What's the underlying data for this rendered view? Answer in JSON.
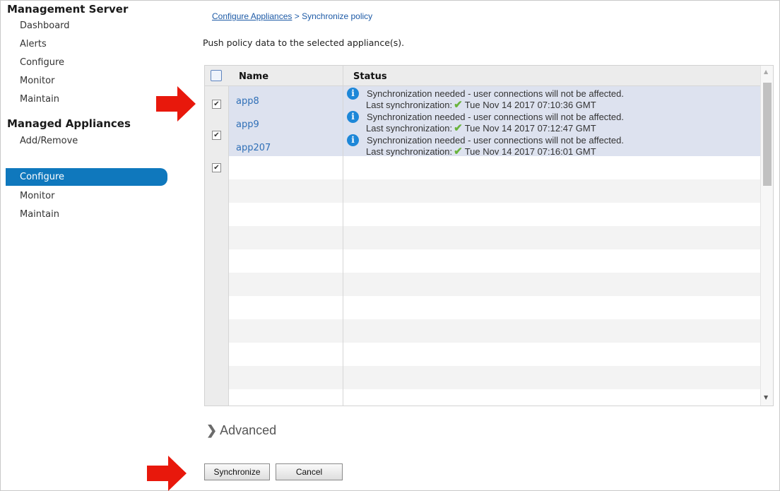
{
  "sidebar": {
    "management_server": {
      "title": "Management Server",
      "items": [
        "Dashboard",
        "Alerts",
        "Configure",
        "Monitor",
        "Maintain"
      ]
    },
    "managed_appliances": {
      "title": "Managed Appliances",
      "items": [
        "Add/Remove",
        "Configure",
        "Monitor",
        "Maintain"
      ],
      "active": "Configure"
    }
  },
  "breadcrumb": {
    "link": "Configure Appliances",
    "separator": ">",
    "current": "Synchronize policy"
  },
  "description": "Push policy data to the selected appliance(s).",
  "table": {
    "headers": {
      "name": "Name",
      "status": "Status"
    },
    "rows": [
      {
        "name": "app8",
        "checked": true,
        "status": "Synchronization needed - user connections will not be affected.",
        "last_sync_label": "Last synchronization:",
        "last_sync": "Tue Nov 14 2017 07:10:36 GMT"
      },
      {
        "name": "app9",
        "checked": true,
        "status": "Synchronization needed - user connections will not be affected.",
        "last_sync_label": "Last synchronization:",
        "last_sync": "Tue Nov 14 2017 07:12:47 GMT"
      },
      {
        "name": "app207",
        "checked": true,
        "status": "Synchronization needed - user connections will not be affected.",
        "last_sync_label": "Last synchronization:",
        "last_sync": "Tue Nov 14 2017 07:16:01 GMT"
      }
    ]
  },
  "advanced": {
    "label": "Advanced"
  },
  "buttons": {
    "synchronize": "Synchronize",
    "cancel": "Cancel"
  },
  "colors": {
    "accent": "#0f78bd",
    "selected_row": "#dde2ef",
    "arrow": "#e8180c",
    "ok_check": "#6ab43d",
    "info": "#1d87d8"
  }
}
